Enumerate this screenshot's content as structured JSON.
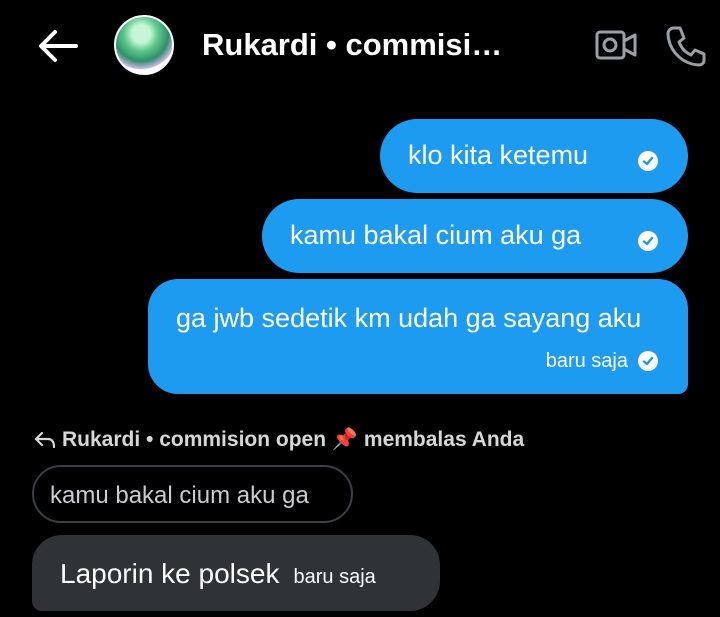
{
  "header": {
    "back_icon": "arrow-left-icon",
    "title": "Rukardi • commisi…",
    "video_icon": "video-call-icon",
    "phone_icon": "phone-icon"
  },
  "messages": [
    {
      "text": "klo kita ketemu",
      "sender": "me",
      "status_icon": "check-circle-icon"
    },
    {
      "text": "kamu bakal cium aku ga",
      "sender": "me",
      "status_icon": "check-circle-icon"
    },
    {
      "text": "ga jwb sedetik km udah ga sayang aku",
      "sender": "me",
      "time": "baru saja",
      "status_icon": "check-circle-icon"
    }
  ],
  "reply": {
    "label_name": "Rukardi • commision open",
    "label_pin": "📌",
    "label_suffix": " membalas Anda",
    "quoted_text": "kamu bakal cium aku ga",
    "text": "Laporin ke polsek",
    "time": "baru saja"
  },
  "colors": {
    "outgoing_bubble": "#1d9bf0",
    "incoming_bubble": "#2f3336",
    "background": "#000000"
  }
}
